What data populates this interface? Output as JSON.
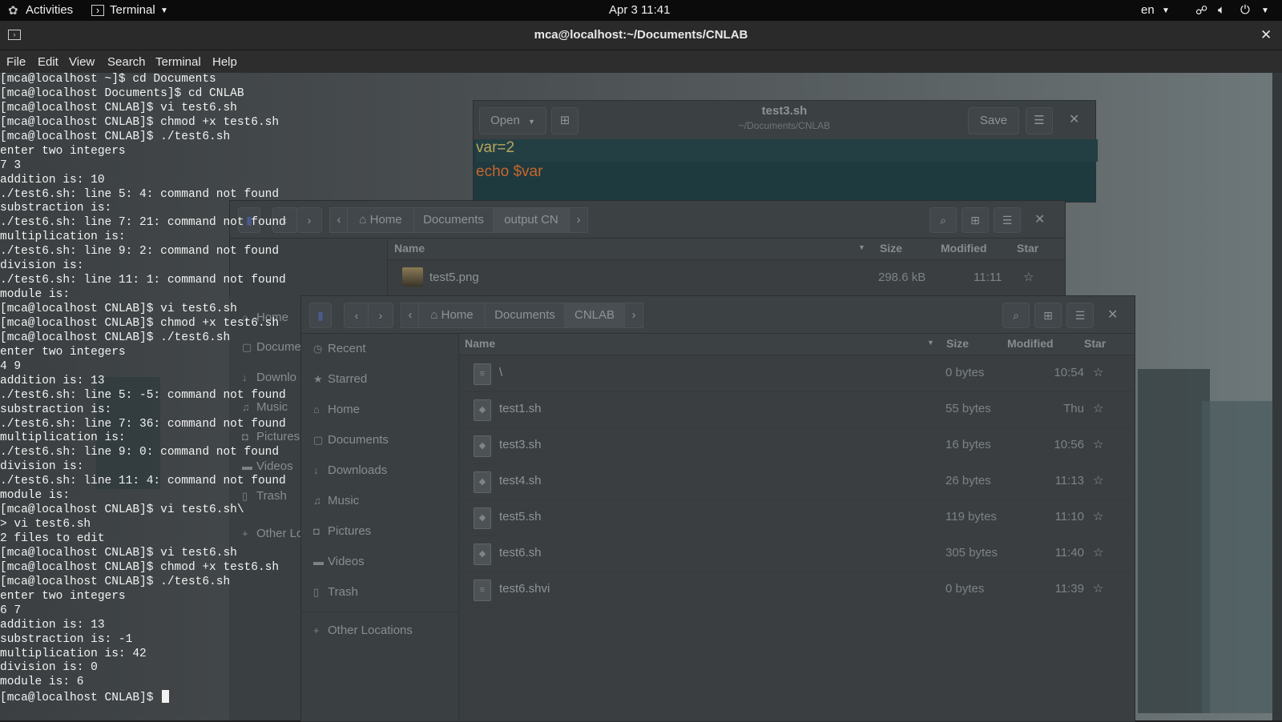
{
  "topbar": {
    "activities": "Activities",
    "app": "Terminal",
    "clock": "Apr 3  11:41",
    "lang": "en"
  },
  "terminal": {
    "title": "mca@localhost:~/Documents/CNLAB",
    "menu": [
      "File",
      "Edit",
      "View",
      "Search",
      "Terminal",
      "Help"
    ],
    "lines": [
      "[mca@localhost ~]$ cd Documents",
      "[mca@localhost Documents]$ cd CNLAB",
      "[mca@localhost CNLAB]$ vi test6.sh",
      "[mca@localhost CNLAB]$ chmod +x test6.sh",
      "[mca@localhost CNLAB]$ ./test6.sh",
      "enter two integers",
      "7 3",
      "addition is: 10",
      "./test6.sh: line 5: 4: command not found",
      "substraction is:",
      "./test6.sh: line 7: 21: command not found",
      "multiplication is:",
      "./test6.sh: line 9: 2: command not found",
      "division is:",
      "./test6.sh: line 11: 1: command not found",
      "module is:",
      "[mca@localhost CNLAB]$ vi test6.sh",
      "[mca@localhost CNLAB]$ chmod +x test6.sh",
      "[mca@localhost CNLAB]$ ./test6.sh",
      "enter two integers",
      "4 9",
      "addition is: 13",
      "./test6.sh: line 5: -5: command not found",
      "substraction is:",
      "./test6.sh: line 7: 36: command not found",
      "multiplication is:",
      "./test6.sh: line 9: 0: command not found",
      "division is:",
      "./test6.sh: line 11: 4: command not found",
      "module is:",
      "[mca@localhost CNLAB]$ vi test6.sh\\",
      "> vi test6.sh",
      "2 files to edit",
      "[mca@localhost CNLAB]$ vi test6.sh",
      "[mca@localhost CNLAB]$ chmod +x test6.sh",
      "[mca@localhost CNLAB]$ ./test6.sh",
      "enter two integers",
      "6 7",
      "addition is: 13",
      "substraction is: -1",
      "multiplication is: 42",
      "division is: 0",
      "module is: 6"
    ],
    "prompt": "[mca@localhost CNLAB]$ "
  },
  "gedit": {
    "open_label": "Open",
    "save_label": "Save",
    "filename": "test3.sh",
    "path": "~/Documents/CNLAB",
    "code_var": "var=2",
    "code_echo_kw": "echo",
    "code_echo_arg": "$var",
    "colors": {
      "bg": "#1e3a3f",
      "kw": "#d0662a"
    }
  },
  "files_back": {
    "crumbs": [
      "Home",
      "Documents",
      "output CN"
    ],
    "cols": {
      "name": "Name",
      "size": "Size",
      "modified": "Modified",
      "star": "Star"
    },
    "file": {
      "name": "test5.png",
      "size": "298.6 kB",
      "modified": "11:11"
    },
    "sidebar_partial": [
      "Home",
      "Docume",
      "Downlo",
      "Music",
      "Pictures",
      "Videos",
      "Trash",
      "Other Lo"
    ]
  },
  "files_front": {
    "crumbs": [
      "Home",
      "Documents",
      "CNLAB"
    ],
    "sidebar": [
      "Recent",
      "Starred",
      "Home",
      "Documents",
      "Downloads",
      "Music",
      "Pictures",
      "Videos",
      "Trash"
    ],
    "other_locations": "Other Locations",
    "cols": {
      "name": "Name",
      "size": "Size",
      "modified": "Modified",
      "star": "Star"
    },
    "files": [
      {
        "name": "\\",
        "size": "0 bytes",
        "modified": "10:54"
      },
      {
        "name": "test1.sh",
        "size": "55 bytes",
        "modified": "Thu"
      },
      {
        "name": "test3.sh",
        "size": "16 bytes",
        "modified": "10:56"
      },
      {
        "name": "test4.sh",
        "size": "26 bytes",
        "modified": "11:13"
      },
      {
        "name": "test5.sh",
        "size": "119 bytes",
        "modified": "11:10"
      },
      {
        "name": "test6.sh",
        "size": "305 bytes",
        "modified": "11:40"
      },
      {
        "name": "test6.shvi",
        "size": "0 bytes",
        "modified": "11:39"
      }
    ]
  }
}
